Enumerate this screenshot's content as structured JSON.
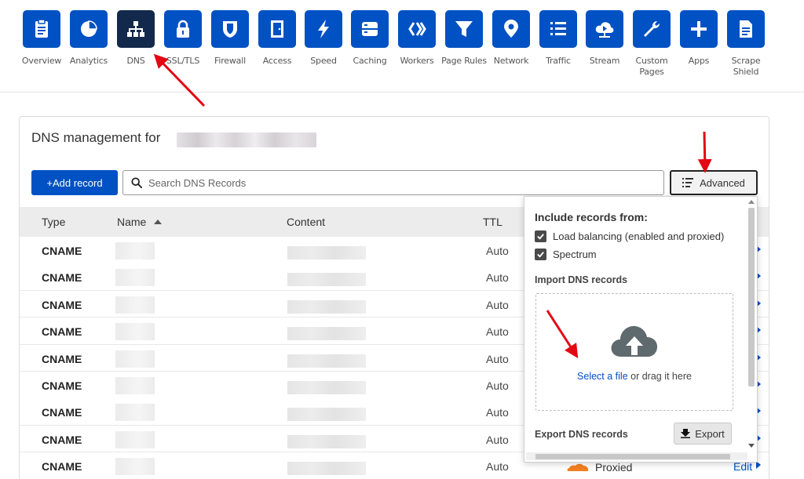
{
  "nav": [
    {
      "id": "overview",
      "label": "Overview",
      "icon": "clipboard-icon"
    },
    {
      "id": "analytics",
      "label": "Analytics",
      "icon": "pie-chart-icon"
    },
    {
      "id": "dns",
      "label": "DNS",
      "icon": "network-tree-icon",
      "active": true
    },
    {
      "id": "ssl",
      "label": "SSL/TLS",
      "icon": "lock-icon"
    },
    {
      "id": "firewall",
      "label": "Firewall",
      "icon": "shield-icon"
    },
    {
      "id": "access",
      "label": "Access",
      "icon": "door-icon"
    },
    {
      "id": "speed",
      "label": "Speed",
      "icon": "lightning-icon"
    },
    {
      "id": "caching",
      "label": "Caching",
      "icon": "server-drive-icon"
    },
    {
      "id": "workers",
      "label": "Workers",
      "icon": "chevrons-icon"
    },
    {
      "id": "page-rules",
      "label": "Page Rules",
      "icon": "filter-icon"
    },
    {
      "id": "network",
      "label": "Network",
      "icon": "location-pin-icon"
    },
    {
      "id": "traffic",
      "label": "Traffic",
      "icon": "list-icon"
    },
    {
      "id": "stream",
      "label": "Stream",
      "icon": "cloud-play-icon"
    },
    {
      "id": "custom-pages",
      "label": "Custom Pages",
      "icon": "wrench-icon"
    },
    {
      "id": "apps",
      "label": "Apps",
      "icon": "plus-icon"
    },
    {
      "id": "scrape-shield",
      "label": "Scrape Shield",
      "icon": "document-icon"
    }
  ],
  "card": {
    "title": "DNS management for",
    "add_record_label": "+Add record",
    "search_placeholder": "Search DNS Records",
    "advanced_label": "Advanced"
  },
  "table": {
    "headers": {
      "type": "Type",
      "name": "Name",
      "content": "Content",
      "ttl": "TTL"
    },
    "rows": [
      {
        "type": "CNAME",
        "ttl": "Auto"
      },
      {
        "type": "CNAME",
        "ttl": "Auto"
      },
      {
        "type": "CNAME",
        "ttl": "Auto"
      },
      {
        "type": "CNAME",
        "ttl": "Auto"
      },
      {
        "type": "CNAME",
        "ttl": "Auto"
      },
      {
        "type": "CNAME",
        "ttl": "Auto"
      },
      {
        "type": "CNAME",
        "ttl": "Auto"
      },
      {
        "type": "CNAME",
        "ttl": "Auto"
      },
      {
        "type": "CNAME",
        "ttl": "Auto",
        "proxy": "Proxied",
        "edit": "Edit"
      }
    ]
  },
  "panel": {
    "include_title": "Include records from:",
    "options": [
      {
        "label": "Load balancing (enabled and proxied)",
        "checked": true
      },
      {
        "label": "Spectrum",
        "checked": true
      }
    ],
    "import_title": "Import DNS records",
    "select_file_link": "Select a file",
    "drag_text": " or drag it here",
    "export_title": "Export DNS records",
    "export_label": "Export"
  },
  "colors": {
    "brand_blue": "#0051c3",
    "nav_active": "#13294b",
    "annotation_red": "#e30613",
    "proxy_orange": "#f38020"
  }
}
